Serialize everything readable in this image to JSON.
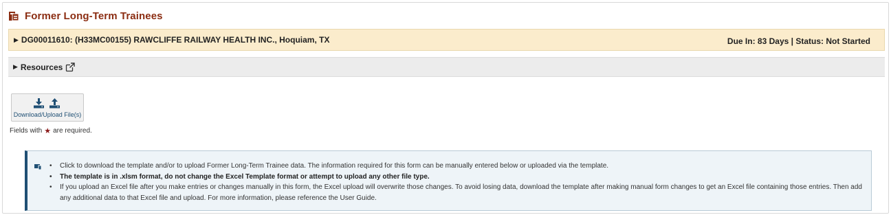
{
  "page": {
    "title": "Former Long-Term Trainees",
    "title_color": "#8b2d12"
  },
  "grant": {
    "label": "DG00011610: (H33MC00155) RAWCLIFFE RAILWAY HEALTH INC., Hoquiam, TX",
    "status": "Due In: 83 Days | Status: Not Started",
    "bar_color": "#fbeccc"
  },
  "resources": {
    "label": "Resources"
  },
  "download_upload": {
    "label": "Download/Upload File(s)",
    "icons": [
      "download-icon",
      "upload-icon"
    ]
  },
  "required_note": {
    "prefix": "Fields with",
    "suffix": "are required."
  },
  "info": {
    "items": [
      "Click to download the template and/or to upload Former Long-Term Trainee data. The information required for this form can be manually entered below or uploaded via the template.",
      "The template is in .xlsm format, do not change the Excel Template format or attempt to upload any other file type.",
      "If you upload an Excel file after you make entries or changes manually in this form, the Excel upload will overwrite those changes. To avoid losing data, download the template after making manual form changes to get an Excel file containing those entries. Then add any additional data to that Excel file and upload. For more information, please reference the User Guide."
    ],
    "accent_color": "#1f4f74"
  }
}
